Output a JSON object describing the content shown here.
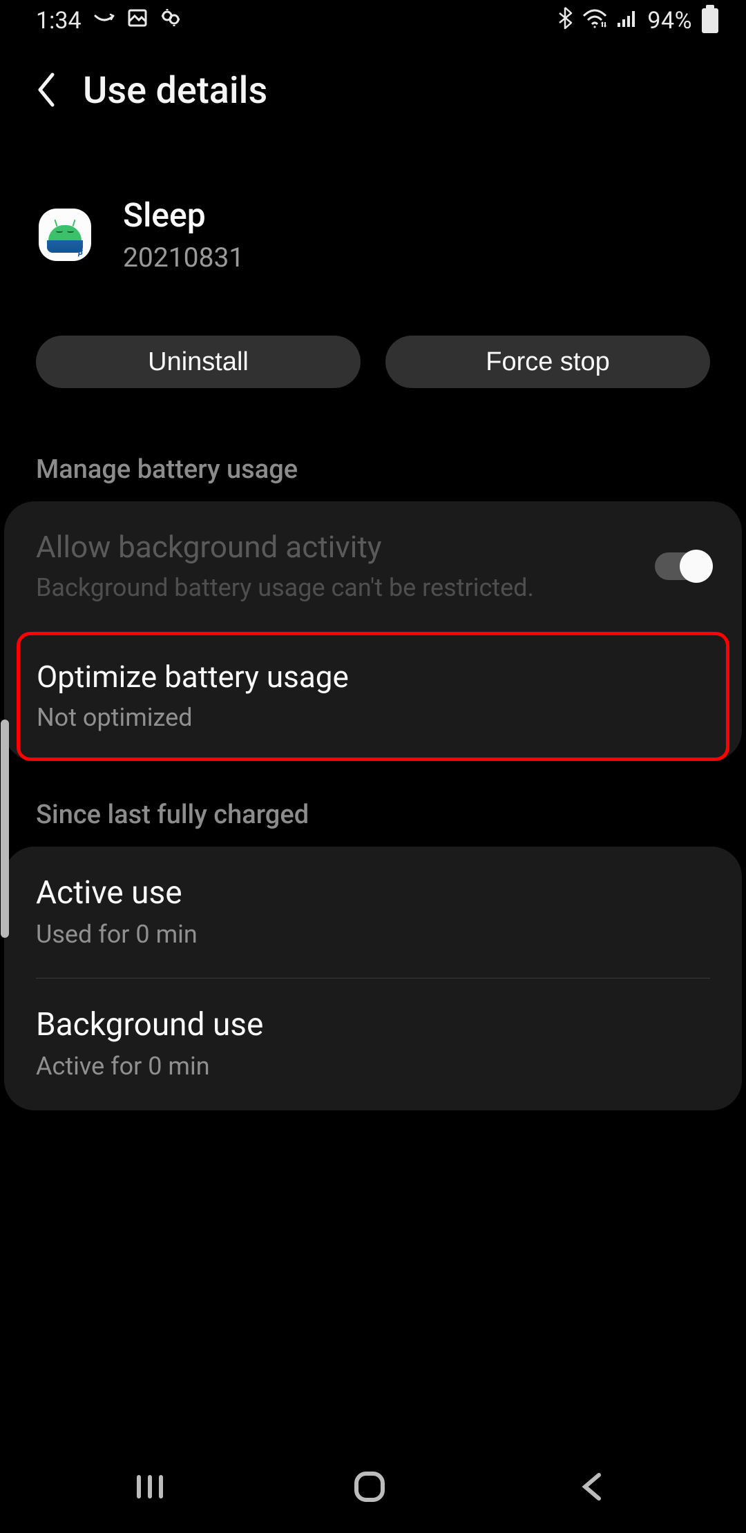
{
  "status": {
    "time": "1:34",
    "battery_pct": "94%"
  },
  "header": {
    "title": "Use details"
  },
  "app": {
    "name": "Sleep",
    "version": "20210831"
  },
  "actions": {
    "uninstall": "Uninstall",
    "force_stop": "Force stop"
  },
  "sections": {
    "manage": {
      "label": "Manage battery usage",
      "bg_activity": {
        "title": "Allow background activity",
        "subtitle": "Background battery usage can't be restricted.",
        "toggle_on": true
      },
      "optimize": {
        "title": "Optimize battery usage",
        "subtitle": "Not optimized"
      }
    },
    "since": {
      "label": "Since last fully charged",
      "active": {
        "title": "Active use",
        "subtitle": "Used for 0 min"
      },
      "background": {
        "title": "Background use",
        "subtitle": "Active for 0 min"
      }
    }
  }
}
